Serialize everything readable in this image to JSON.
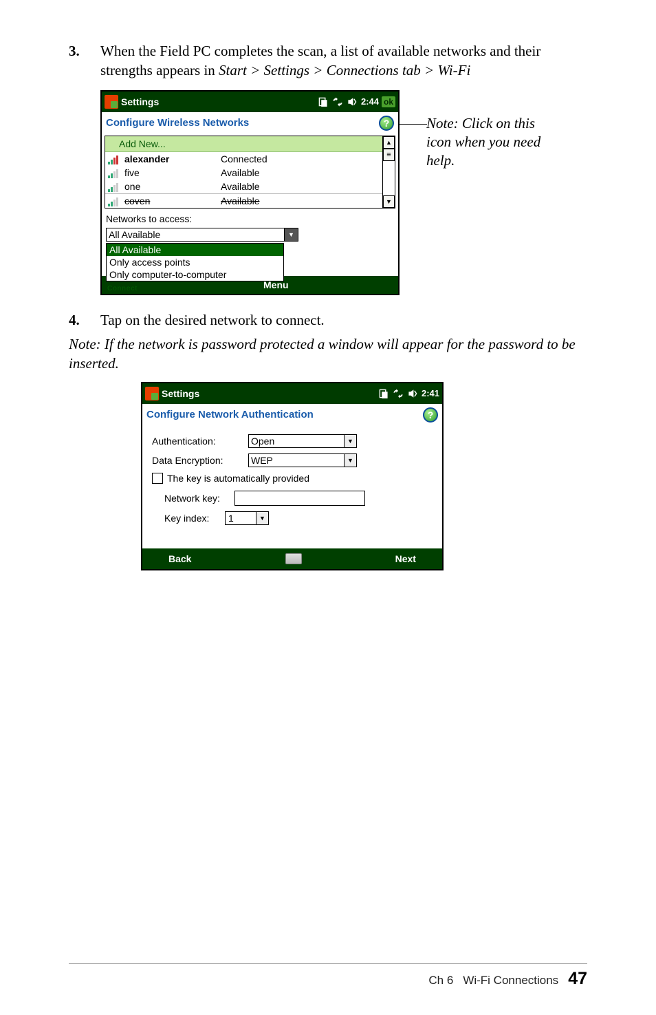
{
  "step3": {
    "num": "3.",
    "text_a": "When the Field PC completes the scan, a list of available networks and their strengths appears in ",
    "path": "Start > Settings > Connections tab > Wi-Fi"
  },
  "fig1": {
    "title": "Settings",
    "time": "2:44",
    "ok": "ok",
    "section": "Configure Wireless Networks",
    "add_new": "Add New...",
    "rows": [
      {
        "name": "alexander",
        "status": "Connected",
        "bold": true
      },
      {
        "name": "five",
        "status": "Available"
      },
      {
        "name": "one",
        "status": "Available"
      },
      {
        "name": "coven",
        "status": "Available",
        "strike": true
      }
    ],
    "networks_label": "Networks to access:",
    "access_value": "All Available",
    "dropdown": [
      "All Available",
      "Only access points",
      "Only computer-to-computer"
    ],
    "menu": "Menu",
    "connect": "Connect"
  },
  "note1": "Note: Click on this icon when you need help.",
  "step4": {
    "num": "4.",
    "text": "Tap on the desired network to connect."
  },
  "note2": "Note:  If the network is password protected a window will appear for the password to be inserted.",
  "fig2": {
    "title": "Settings",
    "time": "2:41",
    "section": "Configure Network Authentication",
    "auth_label": "Authentication:",
    "auth_value": "Open",
    "enc_label": "Data Encryption:",
    "enc_value": "WEP",
    "chk_label": "The key is automatically provided",
    "nkey_label": "Network key:",
    "nkey_value": "",
    "ki_label": "Key index:",
    "ki_value": "1",
    "back": "Back",
    "next": "Next"
  },
  "footer": {
    "chapter": "Ch 6",
    "title": "Wi-Fi Connections",
    "page": "47"
  }
}
